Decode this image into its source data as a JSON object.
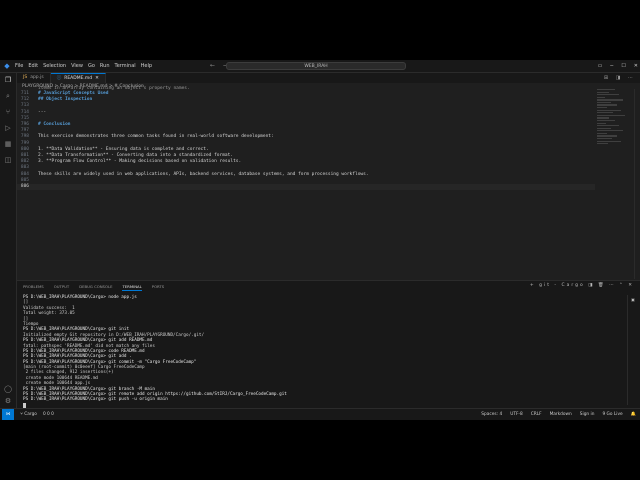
{
  "titlebar": {
    "menus": [
      "File",
      "Edit",
      "Selection",
      "View",
      "Go",
      "Run",
      "Terminal",
      "Help"
    ],
    "search": "WEB_IRAH"
  },
  "tabs": [
    {
      "label": "app.js",
      "icon": "js-file-icon"
    },
    {
      "label": "README.md",
      "icon": "markdown-file-icon",
      "active": true
    }
  ],
  "breadcrumb": "PLAYGROUND > Cargo > README.md > # Conclusion",
  "editor": {
    "lines": [
      {
        "num": "711",
        "text": "# JavaScript Concepts Used",
        "style": "head"
      },
      {
        "num": "712",
        "text": "## Object Inspection",
        "style": "head"
      },
      {
        "num": "713",
        "text": ""
      },
      {
        "num": "714",
        "text": "---"
      },
      {
        "num": "715",
        "text": ""
      },
      {
        "num": "796",
        "text": "# Conclusion",
        "style": "head"
      },
      {
        "num": "797",
        "text": ""
      },
      {
        "num": "798",
        "text": "This exercise demonstrates three common tasks found in real-world software development:"
      },
      {
        "num": "799",
        "text": ""
      },
      {
        "num": "800",
        "text": "1. **Data Validation** - Ensuring data is complete and correct."
      },
      {
        "num": "801",
        "text": "2. **Data Transformation** - Converting data into a standardized format."
      },
      {
        "num": "802",
        "text": "3. **Program Flow Control** - Making decisions based on validation results."
      },
      {
        "num": "803",
        "text": ""
      },
      {
        "num": "804",
        "text": "These skills are widely used in web applications, APIs, backend services, database systems, and form processing workflows."
      },
      {
        "num": "805",
        "text": ""
      },
      {
        "num": "806",
        "text": "",
        "current": true
      }
    ],
    "partial_top": "items in an array containing an object's property names."
  },
  "panel": {
    "tabs": [
      "PROBLEMS",
      "OUTPUT",
      "DEBUG CONSOLE",
      "TERMINAL",
      "PORTS"
    ],
    "active_tab": "TERMINAL",
    "shell_label": "git - Cargo",
    "terminal_lines": [
      "PS D:\\WEB_IRAH\\PLAYGROUND\\Cargo> node app.js",
      "[]",
      "Validate success:  1",
      "Total weight: 373.05",
      "[]",
      "Tiempo",
      "PS D:\\WEB_IRAH\\PLAYGROUND\\Cargo> git init",
      "Initialized empty Git repository in D:/WEB_IRAH/PLAYGROUND/Cargo/.git/",
      "PS D:\\WEB_IRAH\\PLAYGROUND\\Cargo> git add README.md",
      "fatal: pathspec 'README.md' did not match any files",
      "PS D:\\WEB_IRAH\\PLAYGROUND\\Cargo> code README.md",
      "PS D:\\WEB_IRAH\\PLAYGROUND\\Cargo> git add .",
      "PS D:\\WEB_IRAH\\PLAYGROUND\\Cargo> git commit -m \"Cargo FreeCodeCamp\"",
      "[main (root-commit) 0c0eeef] Cargo FreeCodeCamp",
      " 2 files changed, 912 insertions(+)",
      " create mode 100644 README.md",
      " create mode 100644 app.js",
      "PS D:\\WEB_IRAH\\PLAYGROUND\\Cargo> git branch -M main",
      "PS D:\\WEB_IRAH\\PLAYGROUND\\Cargo> git remote add origin https://github.com/StIRJ/Cargo_FreeCodeCamp.git",
      "PS D:\\WEB_IRAH\\PLAYGROUND\\Cargo> git push -u origin main"
    ]
  },
  "statusbar": {
    "branch": "Cargo",
    "problems": "0 0 0",
    "right": [
      "Spaces: 4",
      "UTF-8",
      "CRLF",
      "Markdown",
      "Sign in",
      "9 Go Live"
    ]
  }
}
